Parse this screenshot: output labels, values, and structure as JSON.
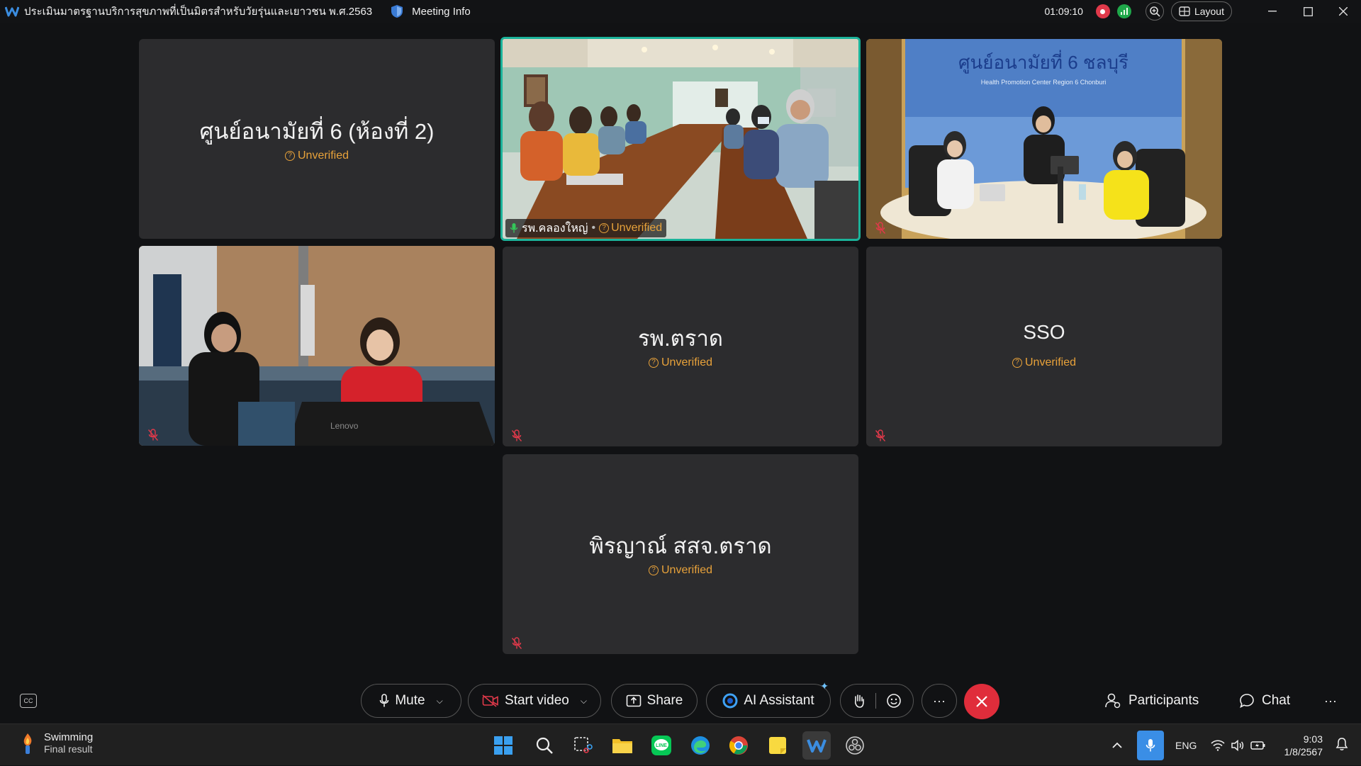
{
  "titlebar": {
    "meeting_title": "ประเมินมาตรฐานบริการสุขภาพที่เป็นมิตรสำหรับวัยรุ่นและเยาวชน พ.ศ.2563",
    "meeting_info_label": "Meeting Info",
    "timer": "01:09:10",
    "layout_label": "Layout",
    "icons": [
      "webex-logo-icon",
      "shield-icon",
      "recording-icon",
      "network-signal-icon",
      "zoom-icon",
      "layout-grid-icon",
      "minimize-icon",
      "maximize-icon",
      "close-icon"
    ]
  },
  "participants": [
    {
      "name": "ศูนย์อนามัยที่ 6 (ห้องที่ 2)",
      "status": "Unverified",
      "video": false
    },
    {
      "name": "รพ.คลองใหญ่",
      "status": "Unverified",
      "video": true,
      "active_speaker": true,
      "scene": "Conference room with a long table and participants wearing masks"
    },
    {
      "name": "",
      "status": "",
      "video": true,
      "muted": true,
      "scene": "Three women at a round table, banner: ศูนย์อนามัยที่ 6 ชลบุรี / Health Promotion Center Region 6 Chonburi"
    },
    {
      "name": "",
      "status": "",
      "video": true,
      "muted": true,
      "scene": "Two women seated in a meeting room with a Lenovo laptop"
    },
    {
      "name": "รพ.ตราด",
      "status": "Unverified",
      "video": false,
      "muted": true
    },
    {
      "name": "SSO",
      "status": "Unverified",
      "video": false,
      "muted": true
    },
    {
      "name": "พิรญาณ์ สสจ.ตราด",
      "status": "Unverified",
      "video": false,
      "muted": true
    }
  ],
  "video_banner": {
    "title": "ศูนย์อนามัยที่ 6 ชลบุรี",
    "subtitle": "Health Promotion Center Region 6 Chonburi"
  },
  "laptop_brand": "Lenovo",
  "controls": {
    "mute_label": "Mute",
    "start_video_label": "Start video",
    "share_label": "Share",
    "ai_assistant_label": "AI Assistant",
    "participants_label": "Participants",
    "chat_label": "Chat",
    "more_label": "···"
  },
  "taskbar": {
    "weather_title": "Swimming",
    "weather_subtitle": "Final result",
    "language": "ENG",
    "time": "9:03",
    "date": "1/8/2567",
    "apps": [
      "windows-start-icon",
      "search-icon",
      "snipping-tool-icon",
      "file-explorer-icon",
      "line-app-icon",
      "edge-browser-icon",
      "chrome-browser-icon",
      "sticky-notes-icon",
      "webex-app-icon",
      "obs-icon"
    ]
  },
  "colors": {
    "accent_teal": "#1bb39a",
    "unverified_orange": "#e8a23a",
    "end_call_red": "#e02d3b",
    "tile_bg": "#2c2c2e",
    "app_bg": "#111214"
  }
}
